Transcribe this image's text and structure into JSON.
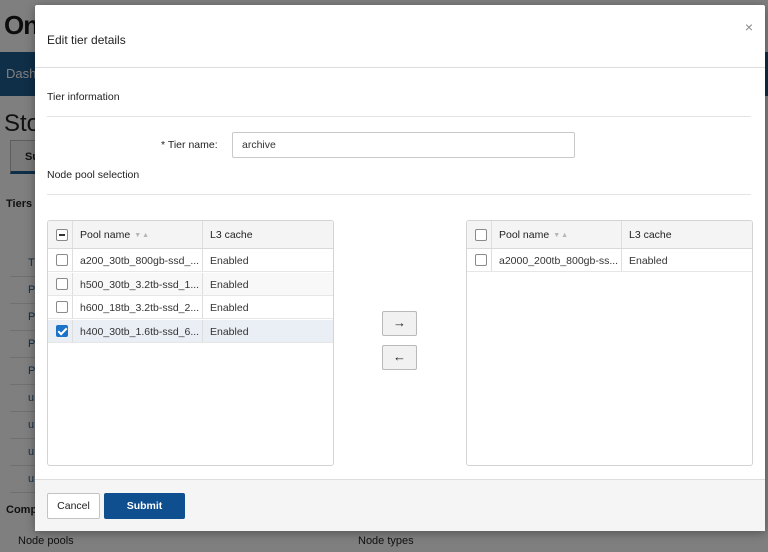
{
  "background": {
    "logo": "On",
    "nav_item": "Dash",
    "heading": "Sto",
    "tab": "Su",
    "tiers_section": "Tiers",
    "rows": [
      "T",
      "P",
      "P",
      "P",
      "P",
      "u",
      "u",
      "u",
      "u"
    ],
    "compute_section": "Comp",
    "bottom_col1": "Node pools",
    "bottom_col2": "Node types"
  },
  "modal": {
    "title": "Edit tier details",
    "close_glyph": "×",
    "tier_info_title": "Tier information",
    "tier_name_required": "*",
    "tier_name_label": "Tier name:",
    "tier_name_value": "archive",
    "node_pool_title": "Node pool selection"
  },
  "left_grid": {
    "col_pool": "Pool name",
    "col_cache": "L3 cache",
    "rows": [
      {
        "name": "a200_30tb_800gb-ssd_...",
        "cache": "Enabled",
        "checked": false
      },
      {
        "name": "h500_30tb_3.2tb-ssd_1...",
        "cache": "Enabled",
        "checked": false
      },
      {
        "name": "h600_18tb_3.2tb-ssd_2...",
        "cache": "Enabled",
        "checked": false
      },
      {
        "name": "h400_30tb_1.6tb-ssd_6...",
        "cache": "Enabled",
        "checked": true
      }
    ]
  },
  "right_grid": {
    "col_pool": "Pool name",
    "col_cache": "L3 cache",
    "rows": [
      {
        "name": "a2000_200tb_800gb-ss...",
        "cache": "Enabled",
        "checked": false
      }
    ]
  },
  "transfer": {
    "move_right": "→",
    "move_left": "←"
  },
  "footer": {
    "cancel_label": "Cancel",
    "submit_label": "Submit"
  },
  "colors": {
    "primary": "#0f4f8f",
    "checkbox_accent": "#1a73c9",
    "navbar": "#1f5c8f"
  },
  "sort_glyph": "▼▲"
}
